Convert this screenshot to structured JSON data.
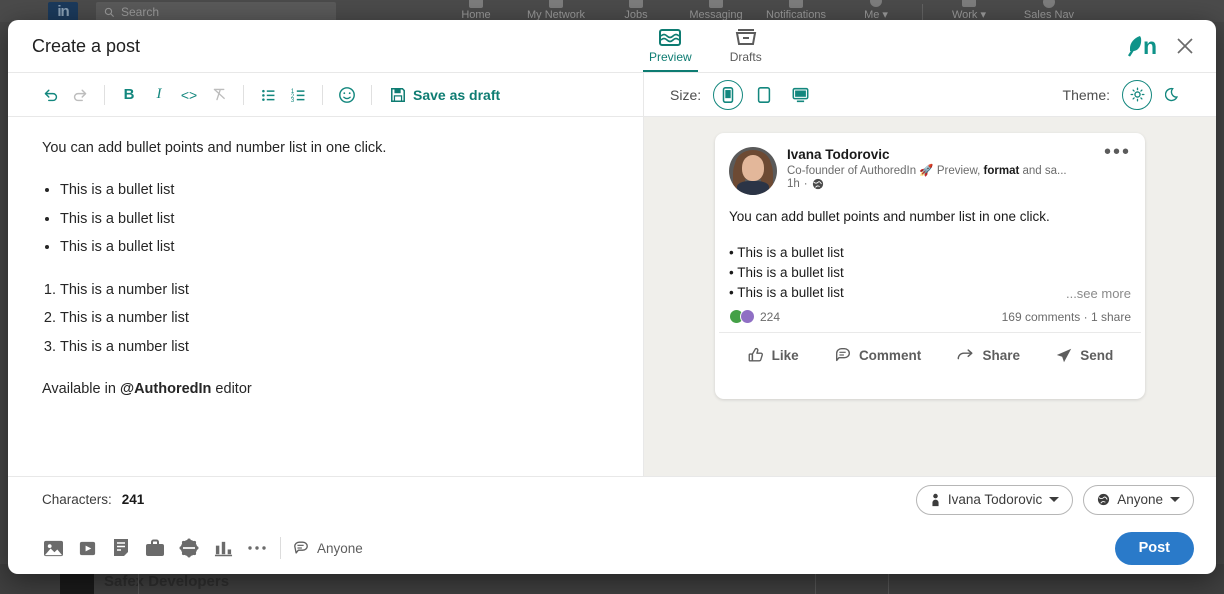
{
  "background": {
    "search_placeholder": "Search",
    "logo_text": "in",
    "nav_items": [
      {
        "label": "Home"
      },
      {
        "label": "My Network"
      },
      {
        "label": "Jobs"
      },
      {
        "label": "Messaging"
      },
      {
        "label": "Notifications"
      },
      {
        "label": "Me ▾"
      },
      {
        "label": "Work ▾"
      },
      {
        "label": "Sales Nav"
      }
    ],
    "bottom_card_title": "Safex Developers"
  },
  "modal": {
    "title": "Create a post",
    "brand": "n",
    "close_label": "✕",
    "tabs": [
      {
        "label": "Preview",
        "icon": "preview-icon",
        "active": true
      },
      {
        "label": "Drafts",
        "icon": "drafts-icon",
        "active": false
      }
    ]
  },
  "editor_toolbar": {
    "undo": "Undo",
    "redo": "Redo",
    "bold": "B",
    "italic": "I",
    "code": "<>",
    "clear_format": "Clear formatting",
    "bullet_list": "Bullet list",
    "numbered_list": "Numbered list",
    "emoji": "Emoji",
    "save_draft_label": "Save as draft"
  },
  "preview_toolbar": {
    "size_label": "Size:",
    "sizes": [
      {
        "name": "mobile",
        "selected": true
      },
      {
        "name": "tablet",
        "selected": false
      },
      {
        "name": "desktop",
        "selected": false
      }
    ],
    "theme_label": "Theme:",
    "themes": [
      {
        "name": "light",
        "selected": true
      },
      {
        "name": "dark",
        "selected": false
      }
    ]
  },
  "editor": {
    "intro": "You can add bullet points and number list in one click.",
    "bullets": [
      "This is a bullet list",
      "This is a bullet list",
      "This is a bullet list"
    ],
    "numbers": [
      "This is a number list",
      "This is a number list",
      "This is a number list"
    ],
    "footer_prefix": "Available in ",
    "footer_mention": "@AuthoredIn",
    "footer_suffix": " editor"
  },
  "post_preview": {
    "author_name": "Ivana Todorovic",
    "headline_prefix": "Co-founder of AuthoredIn 🚀 Preview, ",
    "headline_bold": "format",
    "headline_suffix": " and sa...",
    "time": "1h",
    "visibility_icon": "globe-icon",
    "more_menu": "•••",
    "body": "You can add bullet points and number list in one click.",
    "bullets": [
      "• This is a bullet list",
      "• This is a bullet list",
      "• This is a bullet list"
    ],
    "see_more": "...see more",
    "reactions_count": "224",
    "engagement": "169 comments · 1 share",
    "actions": [
      {
        "label": "Like",
        "icon": "thumbs-up-icon"
      },
      {
        "label": "Comment",
        "icon": "comment-icon"
      },
      {
        "label": "Share",
        "icon": "share-icon"
      },
      {
        "label": "Send",
        "icon": "send-icon"
      }
    ]
  },
  "footer": {
    "characters_label": "Characters:",
    "characters_count": "241",
    "author_pill": "Ivana Todorovic",
    "audience_pill": "Anyone",
    "comment_permission": "Anyone",
    "post_button": "Post",
    "attach_icons": [
      {
        "name": "image-icon"
      },
      {
        "name": "video-icon"
      },
      {
        "name": "document-icon"
      },
      {
        "name": "job-icon"
      },
      {
        "name": "celebrate-icon"
      },
      {
        "name": "poll-icon"
      },
      {
        "name": "more-icon"
      }
    ]
  },
  "colors": {
    "accent": "#0e7c72",
    "brand": "#0e9389",
    "post_button": "#2a7ac9",
    "preview_bg": "#f0efeb"
  }
}
